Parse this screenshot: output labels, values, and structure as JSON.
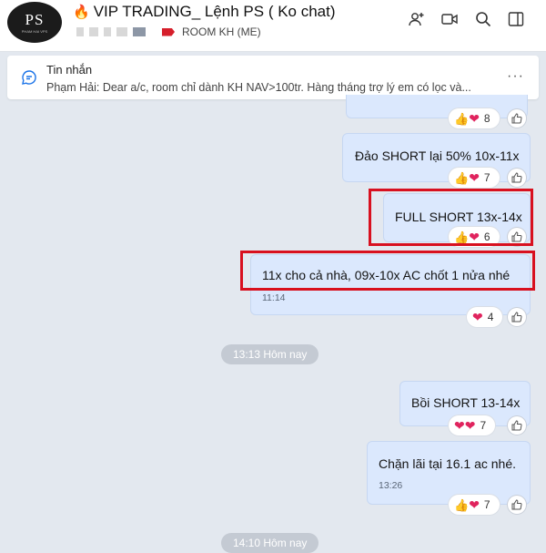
{
  "header": {
    "avatar_text": "PS",
    "avatar_subtext": "PHAM HAI VPS",
    "title": "VIP TRADING_ Lệnh PS ( Ko chat)",
    "room_label": "ROOM KH (ME)",
    "icons": [
      "add-member-icon",
      "video-call-icon",
      "search-icon",
      "sidebar-toggle-icon"
    ]
  },
  "pinned": {
    "title": "Tin nhắn",
    "text": "Phạm Hải: Dear a/c, room chỉ dành KH NAV>100tr. Hàng tháng trợ lý em có lọc và...",
    "more": "···"
  },
  "messages": [
    {
      "text": "",
      "count": "8"
    },
    {
      "text": "Đảo SHORT lại 50% 10x-11x",
      "count": "7"
    },
    {
      "text": "FULL SHORT 13x-14x",
      "count": "6"
    },
    {
      "text": "11x cho cả nhà, 09x-10x AC chốt 1 nửa nhé",
      "time": "11:14",
      "count": "4"
    },
    {
      "text": "Bồi SHORT 13-14x",
      "count": "7"
    },
    {
      "text": "Chặn lãi tại 16.1 ac nhé.",
      "time": "13:26",
      "count": "7"
    }
  ],
  "dividers": [
    "13:13 Hôm nay",
    "14:10 Hôm nay"
  ],
  "colors": {
    "bubble": "#dbe8fd",
    "highlight": "#d8101f",
    "tag": "#d61f2b"
  }
}
